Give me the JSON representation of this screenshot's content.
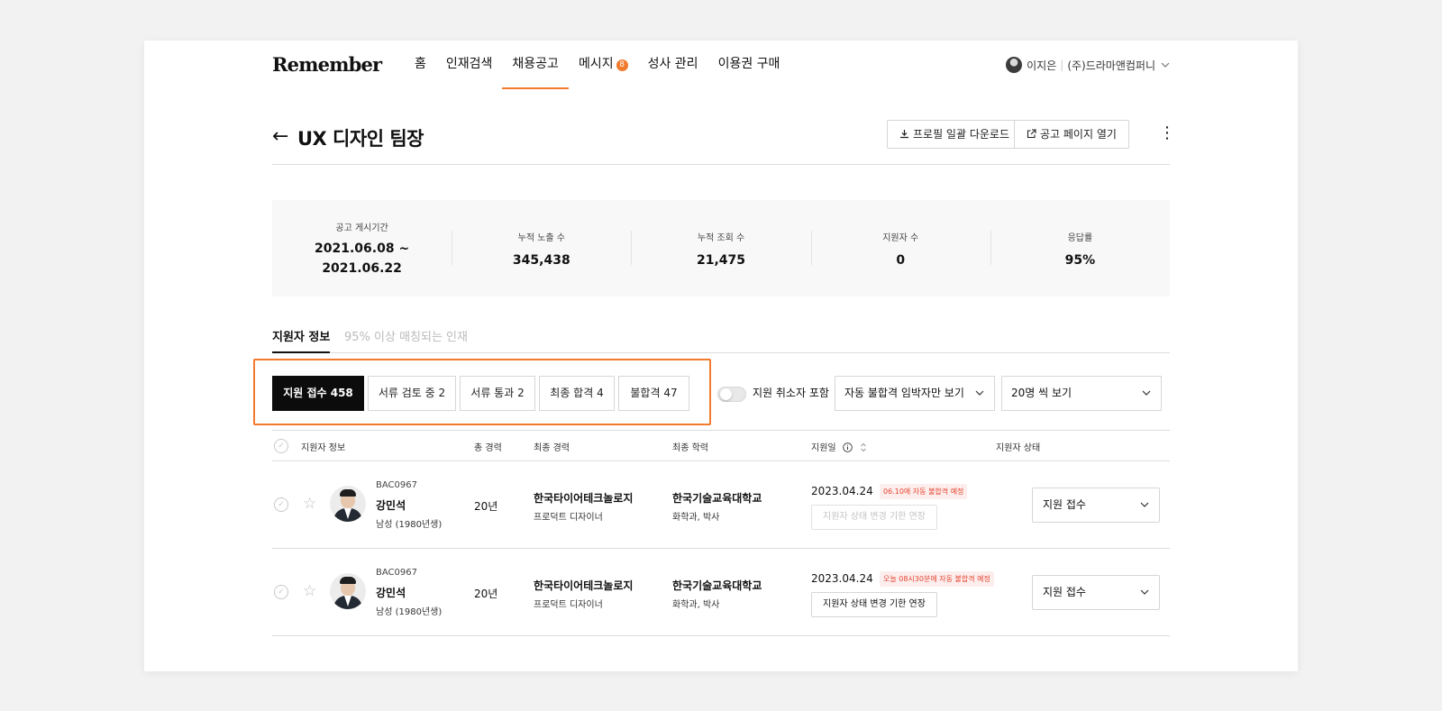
{
  "nav": {
    "logo": "Remember",
    "menu": [
      "홈",
      "인재검색",
      "채용공고",
      "메시지",
      "성사 관리",
      "이용권 구매"
    ],
    "message_badge": "8",
    "user_name": "이지은",
    "separator": "|",
    "company": "(주)드라마앤컴퍼니"
  },
  "title": {
    "back": "←",
    "text": "UX 디자인 팀장",
    "download_label": "프로필 일괄 다운로드",
    "open_label": "공고 페이지 열기",
    "more": "⋮"
  },
  "stats": {
    "period_label": "공고 게시기간",
    "period_start": "2021.06.08 ~",
    "period_end": "2021.06.22",
    "impressions_label": "누적 노출 수",
    "impressions": "345,438",
    "views_label": "누적 조회 수",
    "views": "21,475",
    "applicants_label": "지원자 수",
    "applicants": "0",
    "response_label": "응답률",
    "response": "95%"
  },
  "tabs": [
    "지원자 정보",
    "95% 이상 매칭되는 인재"
  ],
  "filters": {
    "chips": [
      "지원 접수 458",
      "서류 검토 중 2",
      "서류 통과 2",
      "최종 합격 4",
      "불합격 47"
    ],
    "toggle_label": "지원 취소자 포함",
    "reject_select": "자동 불합격 임박자만 보기",
    "page_size_select": "20명 씩 보기"
  },
  "table": {
    "headers": {
      "info": "지원자 정보",
      "career": "총 경력",
      "last_career": "최종 경력",
      "education": "최종 학력",
      "applied": "지원일",
      "status": "지원자 상태"
    },
    "rows": [
      {
        "code": "BAC0967",
        "name": "강민석",
        "gender": "남성 (1980년생)",
        "years": "20년",
        "company": "한국타이어테크놀로지",
        "role": "프로덕트 디자이너",
        "school": "한국기술교육대학교",
        "major": "화학과, 박사",
        "date": "2023.04.24",
        "tag": "06.10에 자동 불합격 예정",
        "extend": "지원자 상태 변경 기한 연장",
        "status": "지원 접수"
      },
      {
        "code": "BAC0967",
        "name": "강민석",
        "gender": "남성 (1980년생)",
        "years": "20년",
        "company": "한국타이어테크놀로지",
        "role": "프로덕트 디자이너",
        "school": "한국기술교육대학교",
        "major": "화학과, 박사",
        "date": "2023.04.24",
        "tag": "오늘 08시30분에 자동 불합격 예정",
        "extend": "지원자 상태 변경 기한 연장",
        "status": "지원 접수"
      }
    ]
  },
  "colors": {
    "accent": "#f27a2c",
    "tag_red": "#e5442f",
    "active_chip": "#0c0c0c"
  }
}
